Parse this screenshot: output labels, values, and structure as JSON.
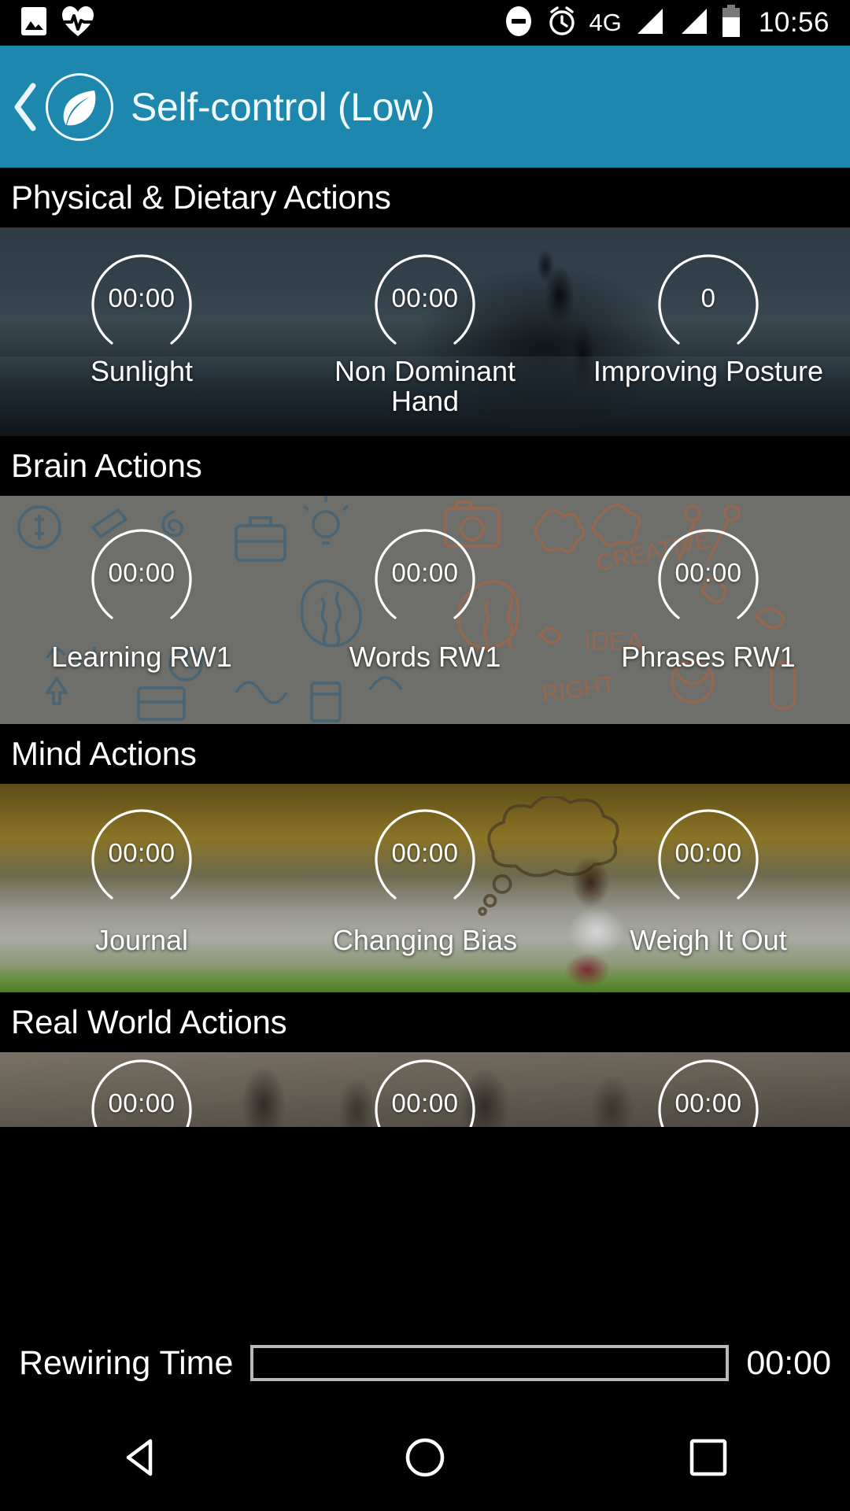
{
  "status_bar": {
    "icons_left": [
      "image-icon",
      "heartbeat-icon"
    ],
    "icons_right": [
      "do-not-disturb-icon",
      "alarm-icon",
      "signal-bar-one-icon",
      "signal-bar-two-icon",
      "battery-icon"
    ],
    "network_label": "4G",
    "clock": "10:56"
  },
  "app_bar": {
    "back_icon": "back-chevron-icon",
    "logo_icon": "leaf-logo-icon",
    "title": "Self-control (Low)",
    "background_color": "#1d87ad"
  },
  "sections": [
    {
      "id": "physical-dietary",
      "title": "Physical & Dietary Actions",
      "background": "beach-runner-photo",
      "actions": [
        {
          "value": "00:00",
          "label": "Sunlight"
        },
        {
          "value": "00:00",
          "label": "Non Dominant Hand"
        },
        {
          "value": "0",
          "label": "Improving Posture"
        }
      ]
    },
    {
      "id": "brain",
      "title": "Brain Actions",
      "background": "grey-doodle-pattern",
      "actions": [
        {
          "value": "00:00",
          "label": "Learning RW1"
        },
        {
          "value": "00:00",
          "label": "Words RW1"
        },
        {
          "value": "00:00",
          "label": "Phrases RW1"
        }
      ]
    },
    {
      "id": "mind",
      "title": "Mind Actions",
      "background": "field-woman-reading-photo",
      "actions": [
        {
          "value": "00:00",
          "label": "Journal"
        },
        {
          "value": "00:00",
          "label": "Changing Bias"
        },
        {
          "value": "00:00",
          "label": "Weigh It Out"
        }
      ]
    },
    {
      "id": "real-world",
      "title": "Real World Actions",
      "background": "crowd-corridor-photo",
      "actions": [
        {
          "value": "00:00",
          "label": ""
        },
        {
          "value": "00:00",
          "label": ""
        },
        {
          "value": "00:00",
          "label": ""
        }
      ]
    }
  ],
  "rewiring": {
    "label": "Rewiring Time",
    "progress_percent": 0,
    "time": "00:00"
  },
  "nav_bar": {
    "back": "triangle-back-icon",
    "home": "circle-home-icon",
    "recents": "square-recents-icon"
  },
  "colors": {
    "accent": "#1d87ad",
    "section_header_bg": "#000000",
    "text": "#ffffff"
  }
}
